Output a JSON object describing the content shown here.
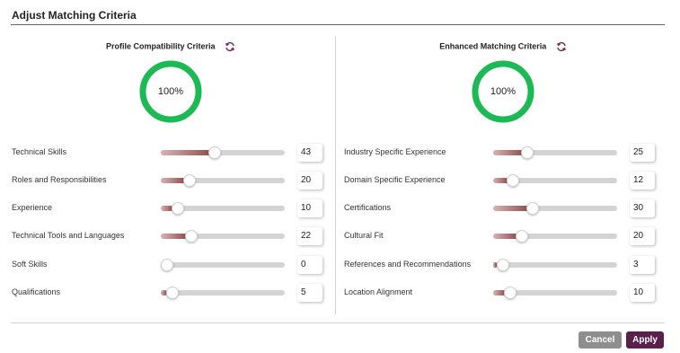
{
  "dialog": {
    "title": "Adjust Matching Criteria"
  },
  "colors": {
    "accent": "#5a1f4a",
    "gauge": "#1db954",
    "slider_fill": "#8d4b4b",
    "refresh_icon": "#6b2d5c"
  },
  "left_panel": {
    "title": "Profile Compatibility Criteria",
    "refresh_icon": "refresh-icon",
    "gauge": {
      "label": "100%",
      "percent": 100
    },
    "criteria": [
      {
        "label": "Technical Skills",
        "value": "43",
        "fraction": 0.43
      },
      {
        "label": "Roles and Responsibilities",
        "value": "20",
        "fraction": 0.2
      },
      {
        "label": "Experience",
        "value": "10",
        "fraction": 0.1
      },
      {
        "label": "Technical Tools and Languages",
        "value": "22",
        "fraction": 0.22
      },
      {
        "label": "Soft Skills",
        "value": "0",
        "fraction": 0
      },
      {
        "label": "Qualifications",
        "value": "5",
        "fraction": 0.05
      }
    ]
  },
  "right_panel": {
    "title": "Enhanced Matching Criteria",
    "refresh_icon": "refresh-icon",
    "gauge": {
      "label": "100%",
      "percent": 100
    },
    "criteria": [
      {
        "label": "Industry Specific Experience",
        "value": "25",
        "fraction": 0.25
      },
      {
        "label": "Domain Specific Experience",
        "value": "12",
        "fraction": 0.12
      },
      {
        "label": "Certifications",
        "value": "30",
        "fraction": 0.3
      },
      {
        "label": "Cultural Fit",
        "value": "20",
        "fraction": 0.2
      },
      {
        "label": "References and Recommendations",
        "value": "3",
        "fraction": 0.03
      },
      {
        "label": "Location Alignment",
        "value": "10",
        "fraction": 0.1
      }
    ]
  },
  "footer": {
    "cancel_label": "Cancel",
    "apply_label": "Apply"
  }
}
